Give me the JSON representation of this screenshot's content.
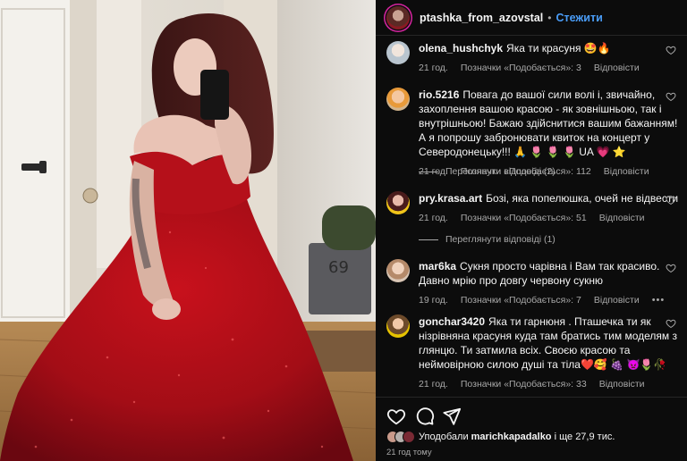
{
  "post": {
    "owner": "ptashka_from_azovstal",
    "separator": "•",
    "follow_label": "Стежити",
    "ring_color": "#d6249f",
    "accent_color": "#4a9df8"
  },
  "comments": [
    {
      "user": "olena_hushchyk",
      "text": "Яка ти красуня 🤩🔥",
      "time": "21 год.",
      "likes": "Позначки «Подобається»: 3",
      "reply": "Відповісти"
    },
    {
      "user": "rio.5216",
      "text": "Повага до вашої сили волі і, звичайно, захоплення вашою красою - як зовнішньою, так і внутрішньою! Бажаю здійснитися вашим бажанням! А я попрошу забронювати квиток на концерт у Северодонецьку!!! 🙏 🌷 🌷 🌷 UA 💗 ⭐",
      "time": "21 год.",
      "likes": "Позначки «Подобається»: 112",
      "reply": "Відповісти",
      "view_replies": "Переглянути відповіді (2)"
    },
    {
      "user": "pry.krasa.art",
      "text": "Бозі, яка попелюшка, очей не відвести",
      "time": "21 год.",
      "likes": "Позначки «Подобається»: 51",
      "reply": "Відповісти",
      "view_replies": "Переглянути відповіді (1)"
    },
    {
      "user": "mar6ka",
      "text": "Сукня просто чарівна і Вам так красиво. Давно мрію про довгу червону сукню",
      "time": "19 год.",
      "likes": "Позначки «Подобається»: 7",
      "reply": "Відповісти",
      "more": "•••"
    },
    {
      "user": "gonchar3420",
      "text": "Яка ти гарнюня . Пташечка ти як нізрівняна красуня куда там братись тим моделям з глянцю. Ти затмила всіх. Своєю красою та неймовірною силою душі та тіла❤️🥰 🍇 👿🌷🥀",
      "time": "21 год.",
      "likes": "Позначки «Подобається»: 33",
      "reply": "Відповісти"
    }
  ],
  "footer": {
    "liked_by_prefix": "Уподобали",
    "liked_by_user": "marichkapadalko",
    "liked_by_suffix": "і ще 27,9 тис.",
    "time_ago": "21 год тому"
  },
  "icons": [
    "heart-icon",
    "comment-icon",
    "share-icon"
  ]
}
